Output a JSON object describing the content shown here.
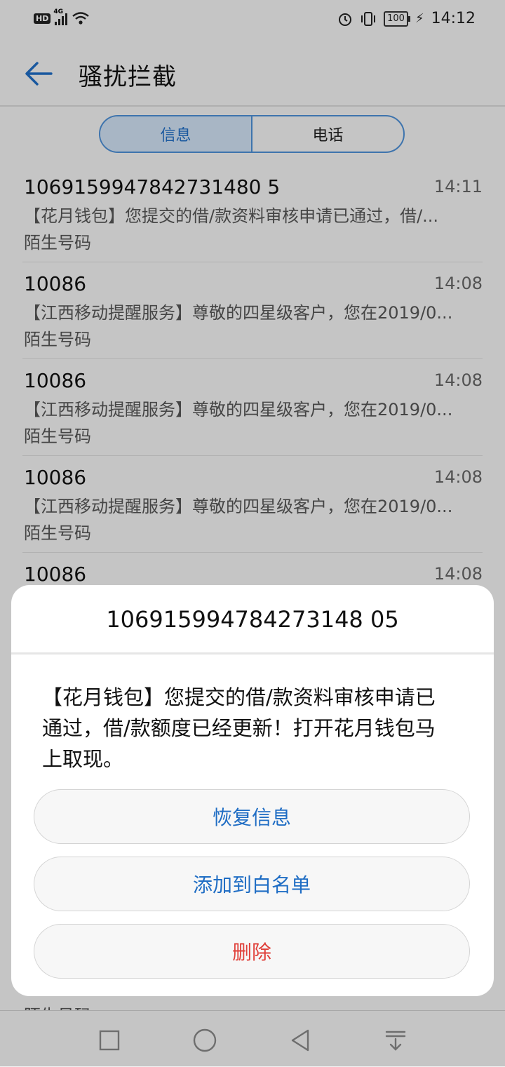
{
  "status_bar": {
    "hd_label": "HD",
    "network_label": "4G",
    "battery_level": "100",
    "time": "14:12"
  },
  "header": {
    "title": "骚扰拦截"
  },
  "tabs": [
    {
      "label": "信息",
      "active": true
    },
    {
      "label": "电话",
      "active": false
    }
  ],
  "messages": [
    {
      "sender": "1069159947842731480 5",
      "time": "14:11",
      "preview": "【花月钱包】您提交的借/款资料审核申请已通过，借/...",
      "tag": "陌生号码"
    },
    {
      "sender": "10086",
      "time": "14:08",
      "preview": "【江西移动提醒服务】尊敬的四星级客户，您在2019/0...",
      "tag": "陌生号码"
    },
    {
      "sender": "10086",
      "time": "14:08",
      "preview": "【江西移动提醒服务】尊敬的四星级客户，您在2019/0...",
      "tag": "陌生号码"
    },
    {
      "sender": "10086",
      "time": "14:08",
      "preview": "【江西移动提醒服务】尊敬的四星级客户，您在2019/0...",
      "tag": "陌生号码"
    },
    {
      "sender": "10086",
      "time": "14:08",
      "preview": "",
      "tag": ""
    }
  ],
  "dialog": {
    "title": "106915994784273148 05",
    "message": "【花月钱包】您提交的借/款资料审核申请已通过，借/款额度已经更新！打开花月钱包马上取现。",
    "buttons": {
      "restore": "恢复信息",
      "whitelist": "添加到白名单",
      "delete": "删除"
    }
  },
  "remnant_text": "陌生号码",
  "colors": {
    "accent": "#1f6dc4",
    "danger": "#e0403a"
  }
}
